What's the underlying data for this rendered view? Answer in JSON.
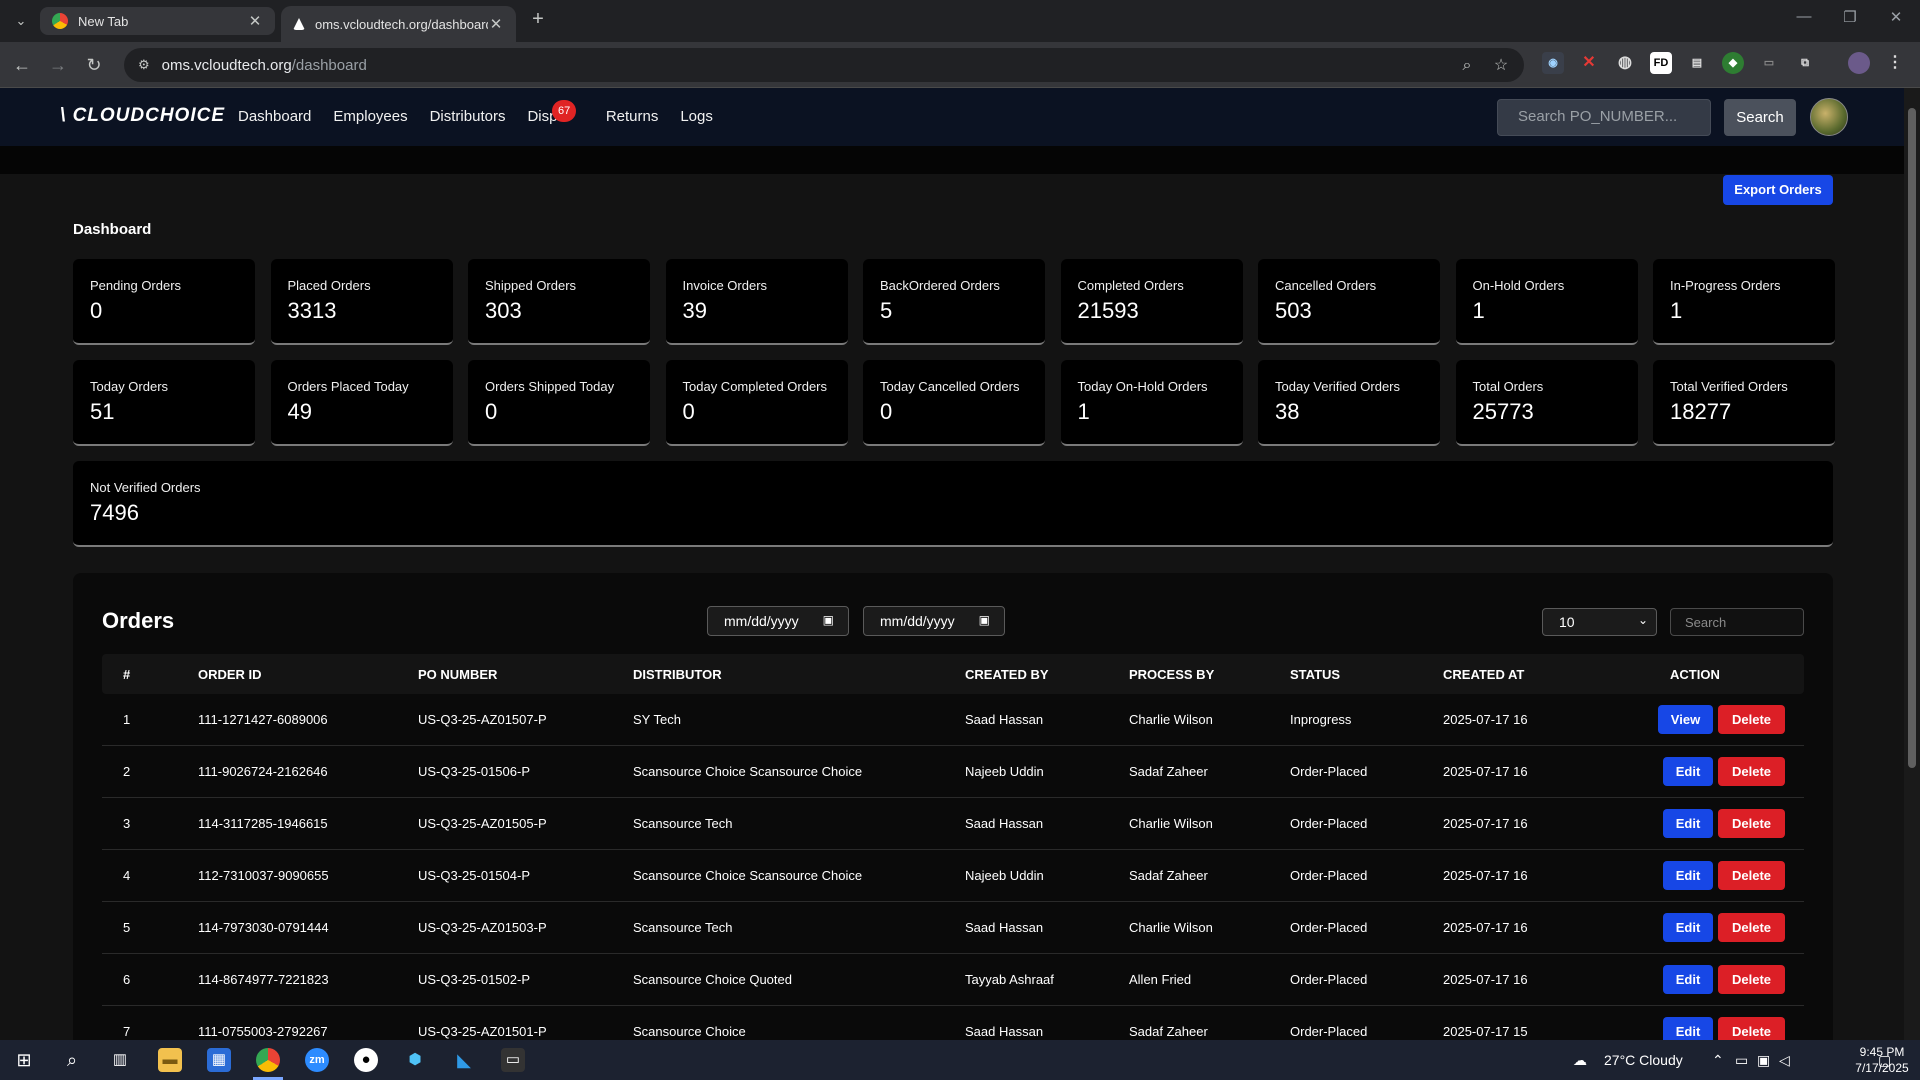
{
  "browser": {
    "tabs": [
      {
        "label": "New Tab",
        "active": false
      },
      {
        "label": "oms.vcloudtech.org/dashboard",
        "active": true
      }
    ],
    "url_host": "oms.vcloudtech.org",
    "url_path": "/dashboard",
    "extensions": [
      "FD"
    ]
  },
  "nav": {
    "logo": "CLOUDCHOICE",
    "links": [
      "Dashboard",
      "Employees",
      "Distributors",
      "Dispu",
      "Returns",
      "Logs"
    ],
    "disputes_badge": "67",
    "search_placeholder": "Search PO_NUMBER...",
    "search_button": "Search"
  },
  "export_button": "Export Orders",
  "page_title": "Dashboard",
  "stats": [
    {
      "label": "Pending Orders",
      "value": "0"
    },
    {
      "label": "Placed Orders",
      "value": "3313"
    },
    {
      "label": "Shipped Orders",
      "value": "303"
    },
    {
      "label": "Invoice Orders",
      "value": "39"
    },
    {
      "label": "BackOrdered Orders",
      "value": "5"
    },
    {
      "label": "Completed Orders",
      "value": "21593"
    },
    {
      "label": "Cancelled Orders",
      "value": "503"
    },
    {
      "label": "On-Hold Orders",
      "value": "1"
    },
    {
      "label": "In-Progress Orders",
      "value": "1"
    },
    {
      "label": "Today Orders",
      "value": "51"
    },
    {
      "label": "Orders Placed Today",
      "value": "49"
    },
    {
      "label": "Orders Shipped Today",
      "value": "0"
    },
    {
      "label": "Today Completed Orders",
      "value": "0"
    },
    {
      "label": "Today Cancelled Orders",
      "value": "0"
    },
    {
      "label": "Today On-Hold Orders",
      "value": "1"
    },
    {
      "label": "Today Verified Orders",
      "value": "38"
    },
    {
      "label": "Total Orders",
      "value": "25773"
    },
    {
      "label": "Total Verified Orders",
      "value": "18277"
    },
    {
      "label": "Not Verified Orders",
      "value": "7496"
    }
  ],
  "orders": {
    "title": "Orders",
    "date_from_placeholder": "mm/dd/yyyy",
    "date_to_placeholder": "mm/dd/yyyy",
    "page_size": "10",
    "search_placeholder": "Search",
    "columns": [
      "#",
      "ORDER ID",
      "PO NUMBER",
      "DISTRIBUTOR",
      "CREATED BY",
      "PROCESS BY",
      "STATUS",
      "CREATED AT",
      "ACTION"
    ],
    "rows": [
      {
        "n": "1",
        "order_id": "111-1271427-6089006",
        "po": "US-Q3-25-AZ01507-P",
        "distributor": "SY Tech",
        "created_by": "Saad Hassan",
        "process_by": "Charlie Wilson",
        "status": "Inprogress",
        "created_at": "2025-07-17 16",
        "primary_action": "View",
        "delete_action": "Delete"
      },
      {
        "n": "2",
        "order_id": "111-9026724-2162646",
        "po": "US-Q3-25-01506-P",
        "distributor": "Scansource Choice Scansource Choice",
        "created_by": "Najeeb Uddin",
        "process_by": "Sadaf Zaheer",
        "status": "Order-Placed",
        "created_at": "2025-07-17 16",
        "primary_action": "Edit",
        "delete_action": "Delete"
      },
      {
        "n": "3",
        "order_id": "114-3117285-1946615",
        "po": "US-Q3-25-AZ01505-P",
        "distributor": "Scansource Tech",
        "created_by": "Saad Hassan",
        "process_by": "Charlie Wilson",
        "status": "Order-Placed",
        "created_at": "2025-07-17 16",
        "primary_action": "Edit",
        "delete_action": "Delete"
      },
      {
        "n": "4",
        "order_id": "112-7310037-9090655",
        "po": "US-Q3-25-01504-P",
        "distributor": "Scansource Choice Scansource Choice",
        "created_by": "Najeeb Uddin",
        "process_by": "Sadaf Zaheer",
        "status": "Order-Placed",
        "created_at": "2025-07-17 16",
        "primary_action": "Edit",
        "delete_action": "Delete"
      },
      {
        "n": "5",
        "order_id": "114-7973030-0791444",
        "po": "US-Q3-25-AZ01503-P",
        "distributor": "Scansource Tech",
        "created_by": "Saad Hassan",
        "process_by": "Charlie Wilson",
        "status": "Order-Placed",
        "created_at": "2025-07-17 16",
        "primary_action": "Edit",
        "delete_action": "Delete"
      },
      {
        "n": "6",
        "order_id": "114-8674977-7221823",
        "po": "US-Q3-25-01502-P",
        "distributor": "Scansource Choice Quoted",
        "created_by": "Tayyab Ashraaf",
        "process_by": "Allen Fried",
        "status": "Order-Placed",
        "created_at": "2025-07-17 16",
        "primary_action": "Edit",
        "delete_action": "Delete"
      },
      {
        "n": "7",
        "order_id": "111-0755003-2792267",
        "po": "US-Q3-25-AZ01501-P",
        "distributor": "Scansource Choice",
        "created_by": "Saad Hassan",
        "process_by": "Sadaf Zaheer",
        "status": "Order-Placed",
        "created_at": "2025-07-17 15",
        "primary_action": "Edit",
        "delete_action": "Delete"
      }
    ]
  },
  "taskbar": {
    "zoom_icon_text": "zm",
    "weather": "27°C  Cloudy",
    "time": "9:45 PM",
    "date": "7/17/2025"
  },
  "colors": {
    "accent_blue": "#1747e6",
    "danger_red": "#dc1f26",
    "nav_bg": "#0b1222"
  }
}
